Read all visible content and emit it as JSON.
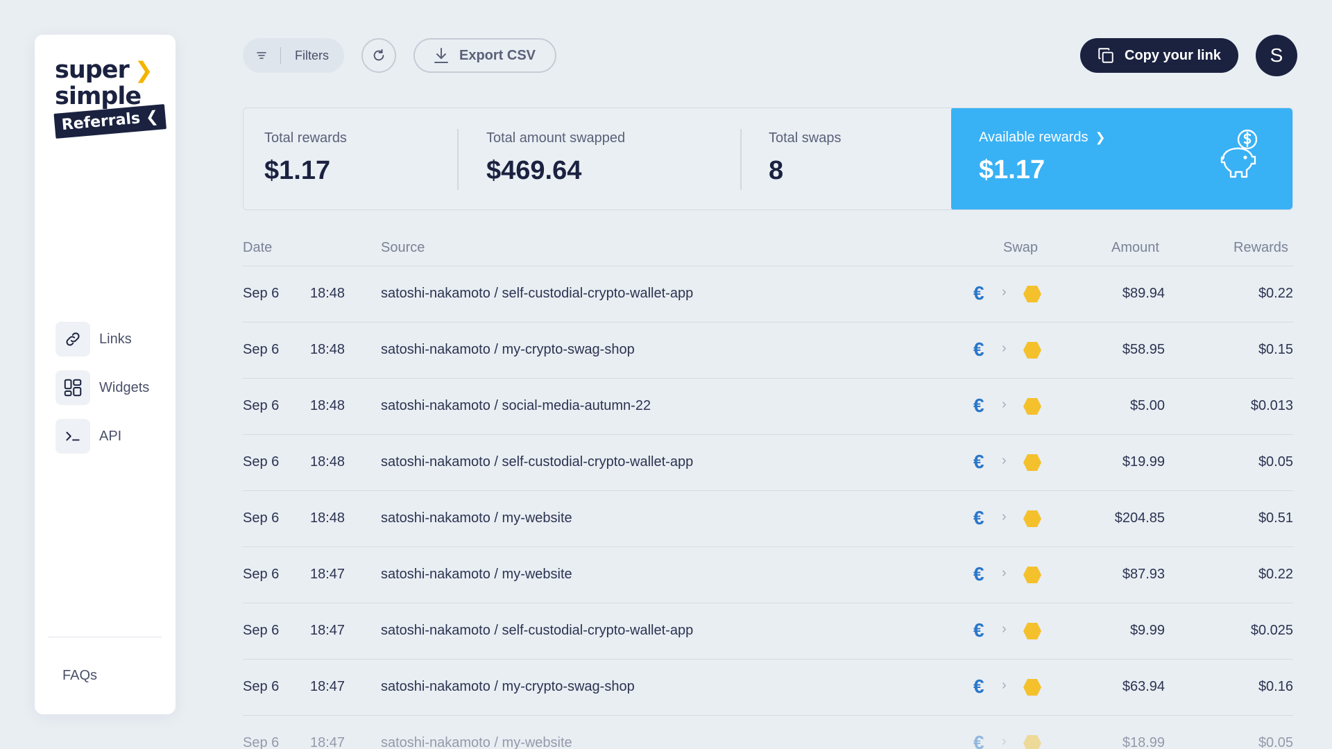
{
  "app": {
    "logo_line1": "super",
    "logo_line2": "simple",
    "logo_tag": "Referrals"
  },
  "sidebar": {
    "items": [
      {
        "label": "Links",
        "icon": "link-icon"
      },
      {
        "label": "Widgets",
        "icon": "widgets-icon"
      },
      {
        "label": "API",
        "icon": "terminal-icon"
      }
    ],
    "faqs": "FAQs"
  },
  "toolbar": {
    "filters_label": "Filters",
    "export_label": "Export CSV",
    "copy_label": "Copy your link",
    "avatar_initial": "S"
  },
  "stats": {
    "total_rewards_label": "Total rewards",
    "total_rewards_value": "$1.17",
    "total_swapped_label": "Total amount swapped",
    "total_swapped_value": "$469.64",
    "total_swaps_label": "Total swaps",
    "total_swaps_value": "8",
    "available_label": "Available rewards",
    "available_value": "$1.17"
  },
  "table": {
    "headers": {
      "date": "Date",
      "source": "Source",
      "swap": "Swap",
      "amount": "Amount",
      "rewards": "Rewards"
    },
    "rows": [
      {
        "date": "Sep 6",
        "time": "18:48",
        "source": "satoshi-nakamoto / self-custodial-crypto-wallet-app",
        "amount": "$89.94",
        "reward": "$0.22"
      },
      {
        "date": "Sep 6",
        "time": "18:48",
        "source": "satoshi-nakamoto / my-crypto-swag-shop",
        "amount": "$58.95",
        "reward": "$0.15"
      },
      {
        "date": "Sep 6",
        "time": "18:48",
        "source": "satoshi-nakamoto / social-media-autumn-22",
        "amount": "$5.00",
        "reward": "$0.013"
      },
      {
        "date": "Sep 6",
        "time": "18:48",
        "source": "satoshi-nakamoto / self-custodial-crypto-wallet-app",
        "amount": "$19.99",
        "reward": "$0.05"
      },
      {
        "date": "Sep 6",
        "time": "18:48",
        "source": "satoshi-nakamoto / my-website",
        "amount": "$204.85",
        "reward": "$0.51"
      },
      {
        "date": "Sep 6",
        "time": "18:47",
        "source": "satoshi-nakamoto / my-website",
        "amount": "$87.93",
        "reward": "$0.22"
      },
      {
        "date": "Sep 6",
        "time": "18:47",
        "source": "satoshi-nakamoto / self-custodial-crypto-wallet-app",
        "amount": "$9.99",
        "reward": "$0.025"
      },
      {
        "date": "Sep 6",
        "time": "18:47",
        "source": "satoshi-nakamoto / my-crypto-swag-shop",
        "amount": "$63.94",
        "reward": "$0.16"
      },
      {
        "date": "Sep 6",
        "time": "18:47",
        "source": "satoshi-nakamoto / my-website",
        "amount": "$18.99",
        "reward": "$0.05"
      }
    ],
    "swap_from_symbol": "€",
    "swap_arrow": "›"
  },
  "colors": {
    "navy": "#1b2240",
    "accent_blue": "#38b1f5",
    "euro_blue": "#2a77c9",
    "token_yellow": "#f4c02c",
    "logo_chevron": "#f4b400"
  }
}
